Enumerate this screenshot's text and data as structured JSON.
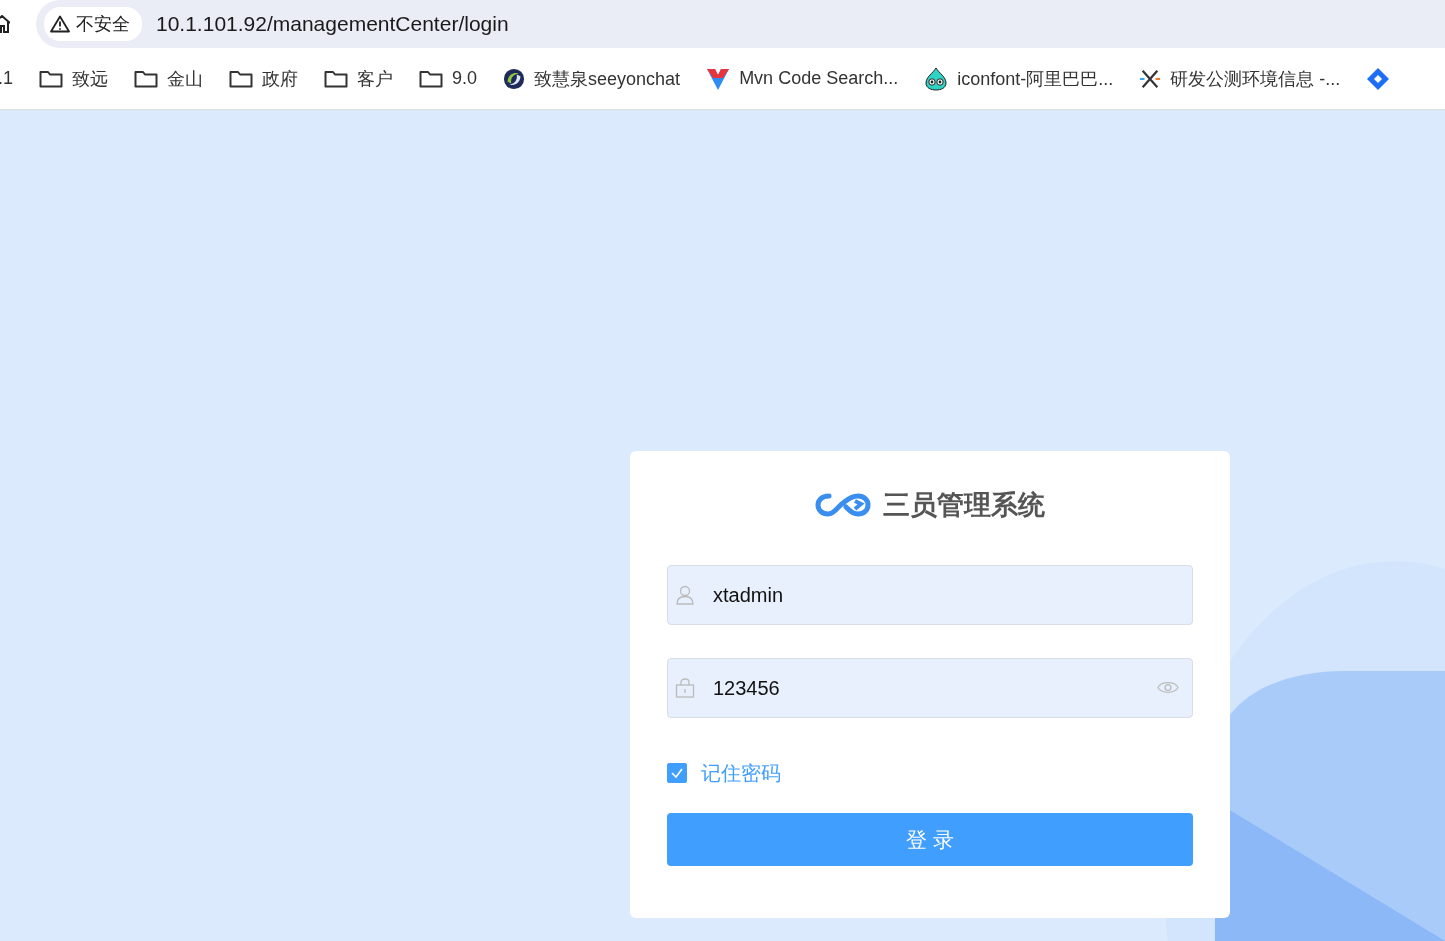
{
  "browser": {
    "security_label": "不安全",
    "url": "10.1.101.92/managementCenter/login"
  },
  "bookmarks": [
    {
      "kind": "text",
      "label": ".1"
    },
    {
      "kind": "folder",
      "label": "致远"
    },
    {
      "kind": "folder",
      "label": "金山"
    },
    {
      "kind": "folder",
      "label": "政府"
    },
    {
      "kind": "folder",
      "label": "客户"
    },
    {
      "kind": "folder",
      "label": "9.0"
    },
    {
      "kind": "swirl",
      "label": "致慧泉seeyonchat"
    },
    {
      "kind": "v",
      "label": "Mvn Code Search..."
    },
    {
      "kind": "mascot",
      "label": "iconfont-阿里巴巴..."
    },
    {
      "kind": "cross",
      "label": "研发公测环境信息 -..."
    },
    {
      "kind": "diamond"
    }
  ],
  "login": {
    "title": "三员管理系统",
    "username": "xtadmin",
    "password": "123456",
    "remember": {
      "label": "记住密码",
      "checked": true
    },
    "submit": "登 录"
  }
}
